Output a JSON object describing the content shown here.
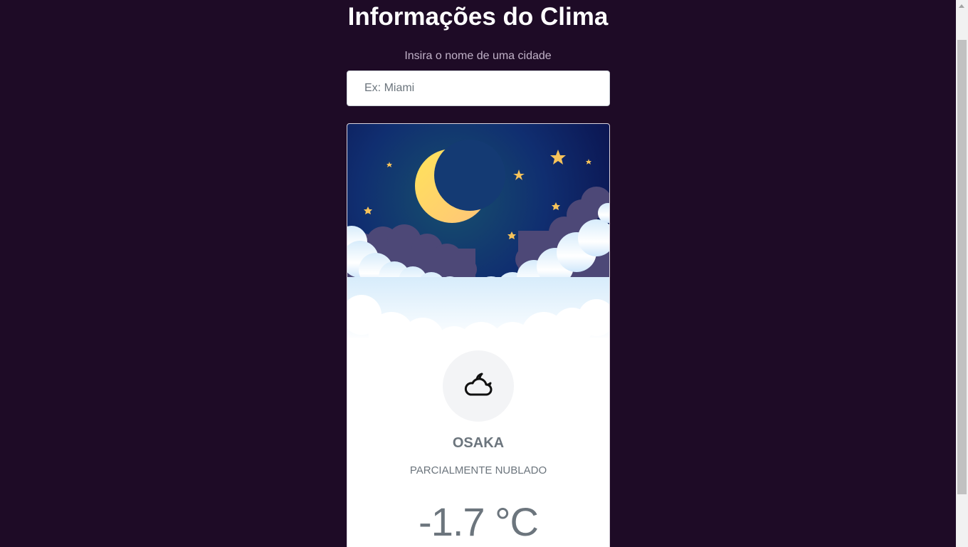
{
  "header": {
    "title": "Informações do Clima"
  },
  "search": {
    "label": "Insira o nome de uma cidade",
    "placeholder": "Ex: Miami",
    "value": ""
  },
  "weather": {
    "city": "OSAKA",
    "condition": "PARCIALMENTE NUBLADO",
    "temperature": "-1.7 °C",
    "icon": "cloud-moon-icon",
    "image": "night-sky-moon-clouds-image"
  },
  "colors": {
    "background": "#1e0b26",
    "card": "#ffffff",
    "text_muted": "#6c757d",
    "label": "#c0b1c7",
    "moon": "#ffd966",
    "star": "#f7c35a",
    "sky_dark": "#0b0d4a",
    "sky_mid": "#143e7c"
  }
}
